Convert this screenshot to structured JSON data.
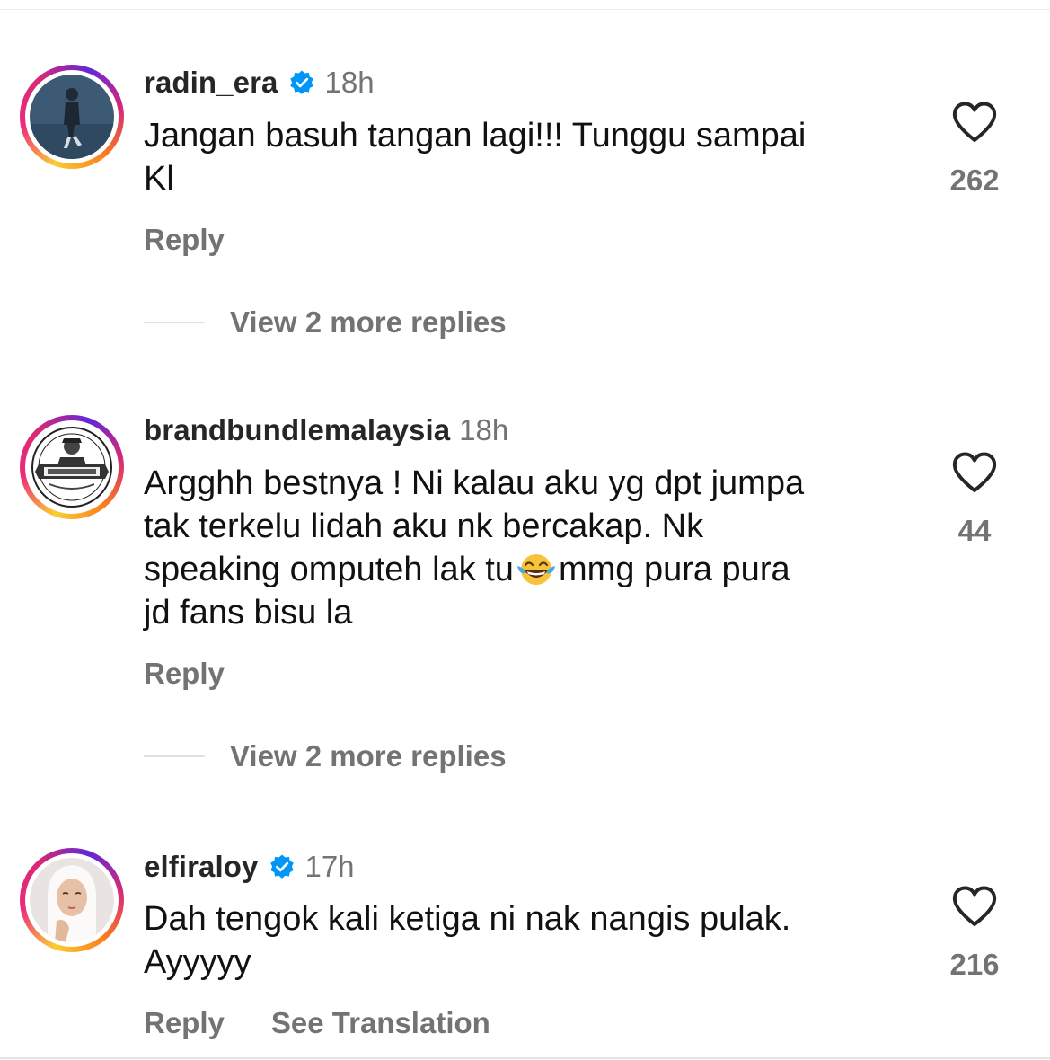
{
  "comments": [
    {
      "username": "radin_era",
      "verified": true,
      "time": "18h",
      "text": "Jangan basuh tangan lagi!!! Tunggu sampai\nKl",
      "likes": "262",
      "reply_label": "Reply",
      "more_replies_label": "View 2 more replies"
    },
    {
      "username": "brandbundlemalaysia",
      "verified": false,
      "time": "18h",
      "text_before_emoji": "Argghh bestnya ! Ni kalau aku yg dpt jumpa\ntak terkelu lidah aku nk bercakap. Nk\nspeaking omputeh lak tu",
      "emoji": "face-with-tears-of-joy-icon",
      "text_after_emoji": "mmg pura pura\njd fans bisu la",
      "likes": "44",
      "reply_label": "Reply",
      "more_replies_label": "View 2 more replies"
    },
    {
      "username": "elfiraloy",
      "verified": true,
      "time": "17h",
      "text": "Dah tengok kali ketiga ni nak nangis pulak.\nAyyyyy",
      "likes": "216",
      "reply_label": "Reply",
      "translate_label": "See Translation"
    }
  ],
  "colors": {
    "username": "#262626",
    "secondary_text": "#737373",
    "verified_badge": "#0095f6",
    "story_ring": [
      "#f9ce34",
      "#ee2a7b",
      "#6228d7"
    ]
  }
}
